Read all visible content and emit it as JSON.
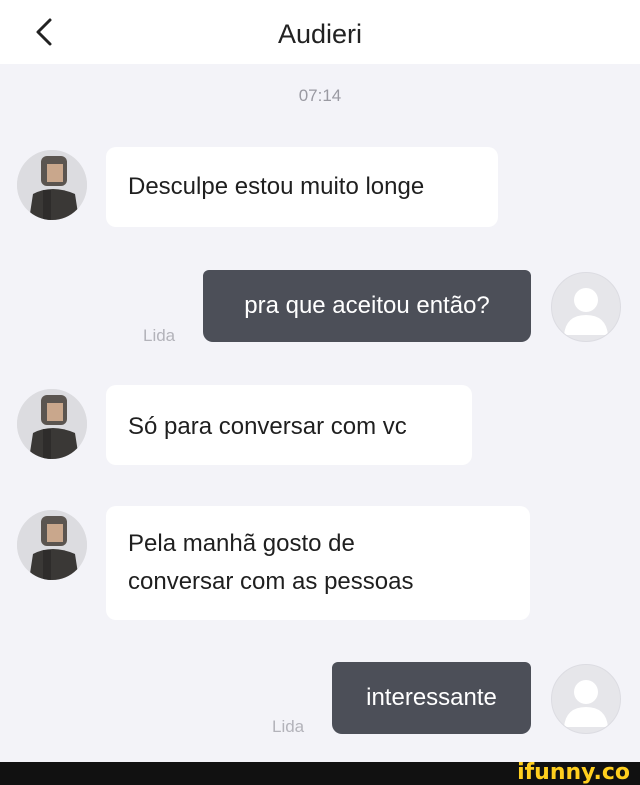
{
  "header": {
    "title": "Audieri",
    "back_icon": "chevron-left-icon"
  },
  "conversation": {
    "timestamp": "07:14",
    "read_label": "Lida",
    "messages": [
      {
        "from": "contact",
        "text": "Desculpe estou muito longe"
      },
      {
        "from": "self",
        "text": "pra que aceitou então?",
        "status": "Lida"
      },
      {
        "from": "contact",
        "text": "Só para conversar com vc"
      },
      {
        "from": "contact",
        "lines": [
          "Pela manhã gosto de",
          "conversar com as pessoas"
        ]
      },
      {
        "from": "self",
        "text": "interessante",
        "status": "Lida"
      }
    ]
  },
  "watermark": {
    "text": "ifunny.co"
  },
  "colors": {
    "background": "#f3f3f8",
    "incoming_bubble": "#ffffff",
    "outgoing_bubble": "#4c4f58",
    "read_label": "#b3b3ba",
    "watermark": "#ffcf1e"
  }
}
